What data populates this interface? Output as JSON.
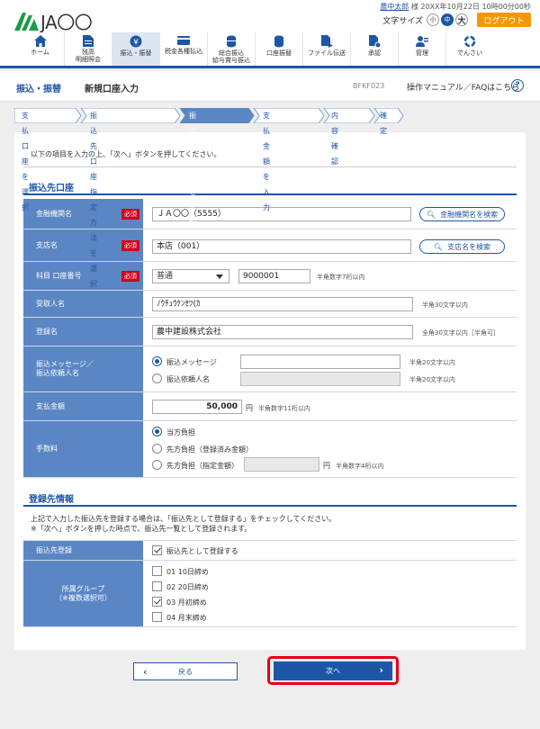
{
  "header": {
    "logo_text": "JA〇〇",
    "user_name": "農中太郎",
    "user_suffix": "様",
    "last_login": "20XX年10月22日 10時00分00秒",
    "font_size_label": "文字サイズ",
    "font_sizes": [
      "小",
      "中",
      "大"
    ],
    "logout_label": "ログアウト"
  },
  "nav": {
    "items": [
      {
        "label": "ホーム",
        "icon": "home-icon"
      },
      {
        "label": "残高\n明細照会",
        "icon": "document-icon"
      },
      {
        "label": "振込・振替",
        "icon": "yen-transfer-icon"
      },
      {
        "label": "税金各種払込",
        "icon": "card-icon"
      },
      {
        "label": "総合振込\n給与賞与振込",
        "icon": "coins-stack-icon"
      },
      {
        "label": "口座振替",
        "icon": "coins-icon"
      },
      {
        "label": "ファイル伝送",
        "icon": "file-transfer-icon"
      },
      {
        "label": "承認",
        "icon": "approval-icon"
      },
      {
        "label": "管理",
        "icon": "admin-icon"
      },
      {
        "label": "でんさい",
        "icon": "densai-icon"
      }
    ]
  },
  "titlebar": {
    "section": "振込・振替",
    "title": "新規口座入力",
    "screen_code": "BFKF023",
    "help_text": "操作マニュアル／FAQはこちら",
    "help_icon": "?"
  },
  "steps": [
    "支払口座を選択",
    "振込先口座指定方法を選択",
    "振込先口座を選択",
    "支払金額を入力",
    "内容確認",
    "確定"
  ],
  "intro": "以下の項目を入力の上、「次へ」ボタンを押してください。",
  "payee_section": {
    "title": "振込先口座",
    "required_label": "必須",
    "bank_label": "金融機関名",
    "bank_value": "ＪＡ〇〇（5555）",
    "bank_search": "金融機関名を検索",
    "branch_label": "支店名",
    "branch_value": "本店（001）",
    "branch_search": "支店名を検索",
    "account_label": "科目 口座番号",
    "account_type": "普通",
    "account_number": "9000001",
    "account_hint": "半角数字7桁以内",
    "recipient_label": "受取人名",
    "recipient_value": "ﾉｳﾁｭｳｹﾝｾﾂ(ｶ",
    "recipient_hint": "半角30文字以内",
    "register_label": "登録名",
    "register_value": "農中建設株式会社",
    "register_hint": "全角30文字以内［半角可］",
    "message_label": "振込メッセージ／\n振込依頼人名",
    "message_option": "振込メッセージ",
    "message_hint": "半角20文字以内",
    "requester_option": "振込依頼人名",
    "requester_hint": "半角20文字以内",
    "amount_label": "支払金額",
    "amount_value": "50,000",
    "amount_unit": "円",
    "amount_hint": "半角数字11桁以内",
    "fee_label": "手数料",
    "fee_option1": "当方負担",
    "fee_option2": "先方負担（登録済み金額）",
    "fee_option3": "先方負担（指定金額）",
    "fee_unit": "円",
    "fee_hint": "半角数字4桁以内"
  },
  "registration_section": {
    "title": "登録先情報",
    "note1": "上記で入力した振込先を登録する場合は、「振込先として登録する」をチェックしてください。",
    "note2": "※「次へ」ボタンを押した時点で、振込先一覧として登録されます。",
    "register_label": "振込先登録",
    "register_option": "振込先として登録する",
    "group_label": "所属グループ\n（※複数選択可）",
    "groups": [
      {
        "label": "01 10日締め",
        "checked": false
      },
      {
        "label": "02 20日締め",
        "checked": false
      },
      {
        "label": "03 月初締め",
        "checked": true
      },
      {
        "label": "04 月末締め",
        "checked": false
      }
    ]
  },
  "buttons": {
    "back": "戻る",
    "next": "次へ"
  },
  "colors": {
    "primary": "#1e56a6",
    "label_bg": "#5b86c4",
    "required": "#d0021b",
    "logout": "#f39800",
    "highlight": "#e60012"
  }
}
